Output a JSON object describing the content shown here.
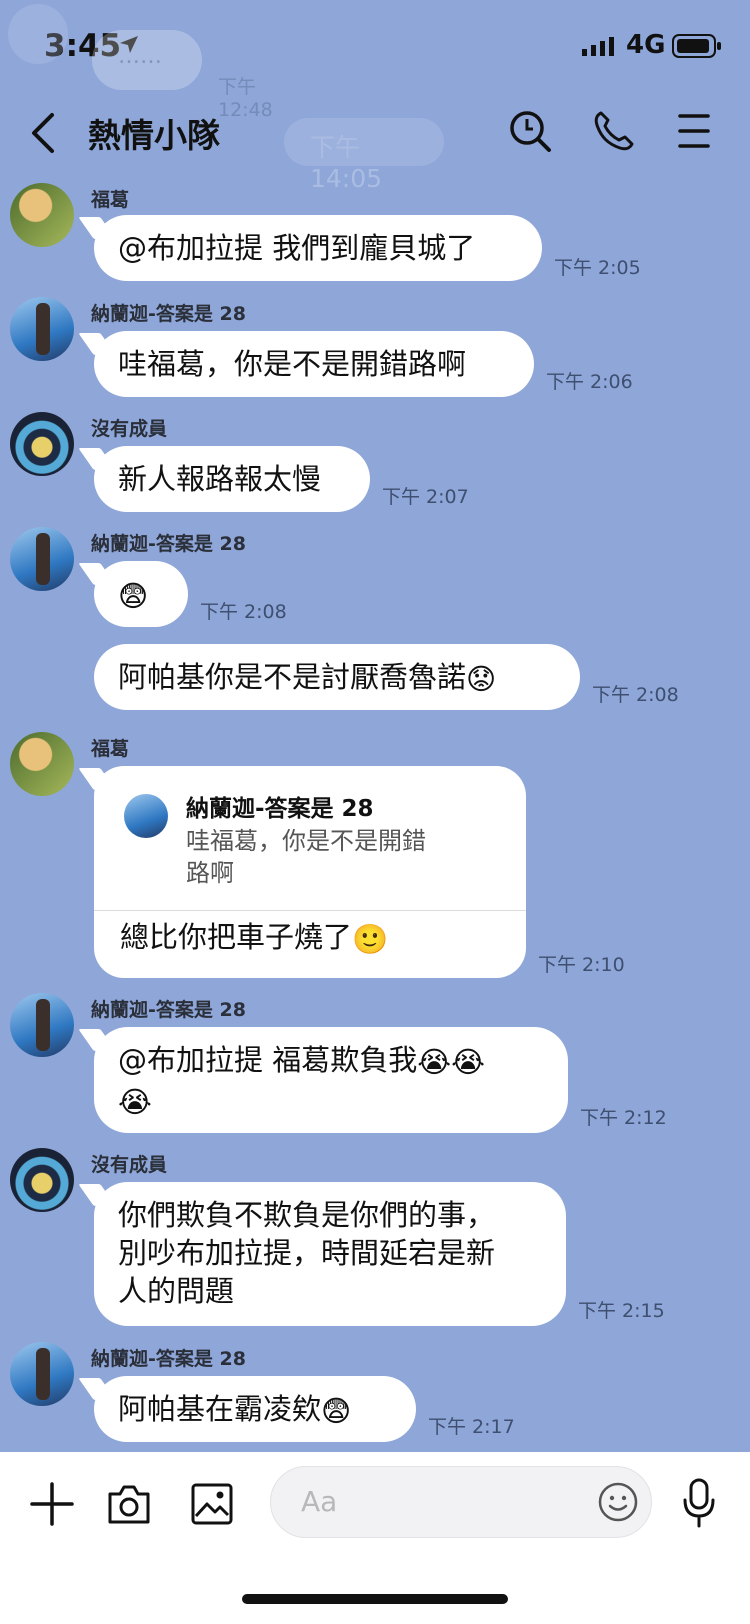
{
  "status_bar": {
    "time": "3:45",
    "network": "4G"
  },
  "background_ghost": {
    "top_dots": "……",
    "top_time": "下午 12:48",
    "mid_time": "下午 14:05"
  },
  "header": {
    "title": "熱情小隊"
  },
  "messages": [
    {
      "sender": "福葛",
      "text": "@布加拉提 我們到龐貝城了",
      "time": "下午 2:05"
    },
    {
      "sender": "納蘭迦-答案是 28",
      "text": "哇福葛，你是不是開錯路啊",
      "time": "下午 2:06"
    },
    {
      "sender": "沒有成員",
      "text": "新人報路報太慢",
      "time": "下午 2:07"
    },
    {
      "sender": "納蘭迦-答案是 28",
      "emoji": "😨",
      "time": "下午 2:08"
    },
    {
      "text": "阿帕基你是不是討厭喬魯諾",
      "emoji": "😟",
      "time": "下午 2:08"
    },
    {
      "sender": "福葛",
      "reply": {
        "name": "納蘭迦-答案是 28",
        "line1": "哇福葛，你是不是開錯",
        "line2": "路啊"
      },
      "text": "總比你把車子燒了",
      "emoji": "🙂",
      "time": "下午 2:10"
    },
    {
      "sender": "納蘭迦-答案是 28",
      "line1": "@布加拉提 福葛欺負我",
      "line1_emoji": "😭😭",
      "line2_emoji": "😭",
      "time": "下午 2:12"
    },
    {
      "sender": "沒有成員",
      "line1": "你們欺負不欺負是你們的事，",
      "line2": "別吵布加拉提，時間延宕是新",
      "line3": "人的問題",
      "time": "下午 2:15"
    },
    {
      "sender": "納蘭迦-答案是 28",
      "text": "阿帕基在霸凌欸",
      "emoji": "😨",
      "time": "下午 2:17"
    }
  ],
  "input": {
    "placeholder": "Aa"
  },
  "icons": [
    "location-arrow-icon",
    "signal-icon",
    "battery-icon",
    "back-chevron-icon",
    "search-icon",
    "phone-icon",
    "menu-icon",
    "plus-icon",
    "camera-icon",
    "image-icon",
    "emoji-icon",
    "microphone-icon"
  ]
}
